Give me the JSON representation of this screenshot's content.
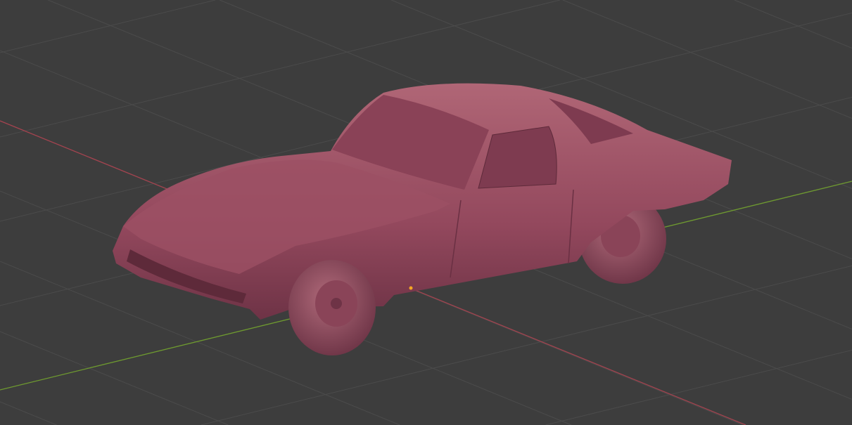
{
  "viewport": {
    "name": "3D Viewport",
    "background": "#3d3d3d",
    "grid_color": "#4b4b4b",
    "x_axis_color": "#a3434f",
    "y_axis_color": "#6e9a2f",
    "model_color": "#a0546a",
    "model_shadow": "#6e3346",
    "model_highlight": "#bb7484",
    "origin_color": "#f5a623"
  }
}
